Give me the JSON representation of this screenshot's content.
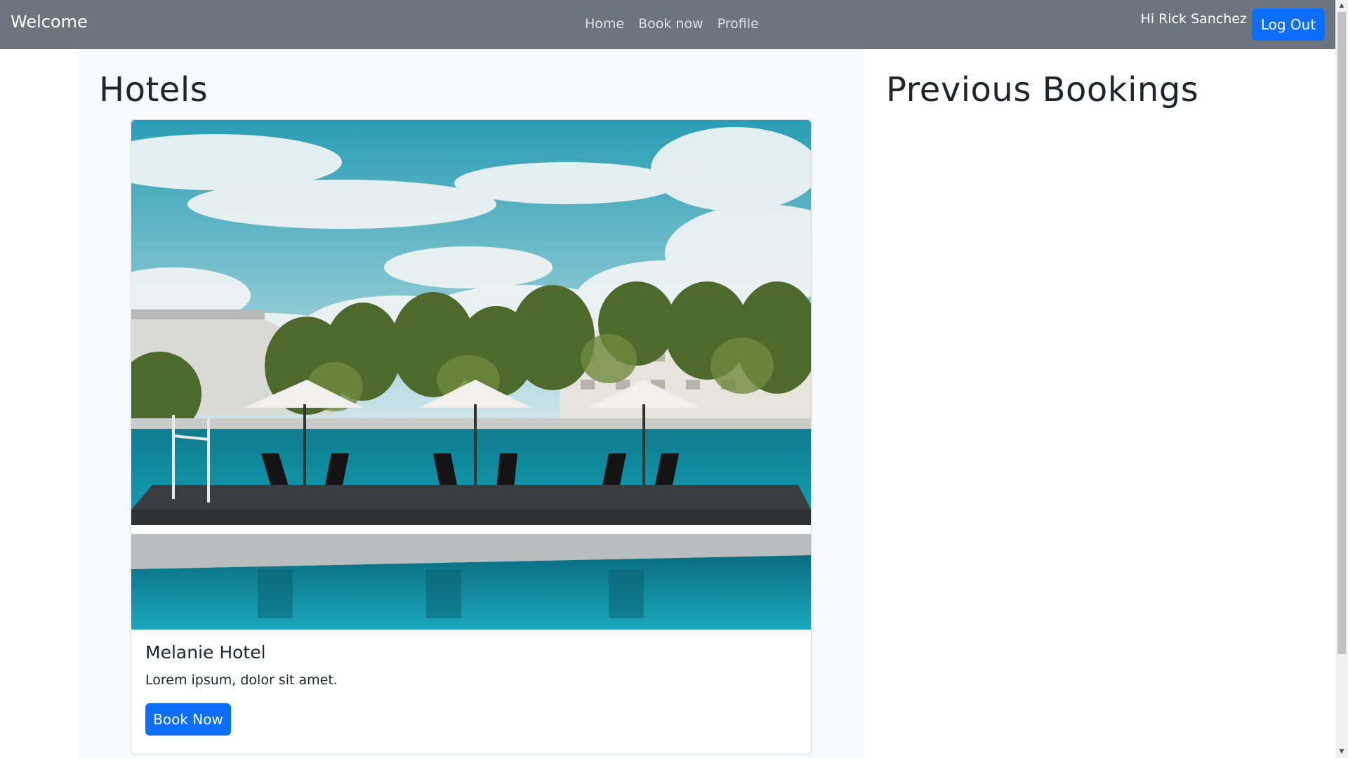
{
  "navbar": {
    "brand": "Welcome",
    "links": [
      {
        "label": "Home"
      },
      {
        "label": "Book now"
      },
      {
        "label": "Profile"
      }
    ],
    "greeting": "Hi Rick Sanchez",
    "logout_label": "Log Out"
  },
  "hotels": {
    "title": "Hotels",
    "cards": [
      {
        "name": "Melanie Hotel",
        "description": "Lorem ipsum, dolor sit amet.",
        "button_label": "Book Now"
      }
    ]
  },
  "bookings": {
    "title": "Previous Bookings"
  },
  "colors": {
    "navbar_bg": "#6c757d",
    "primary": "#0d6efd",
    "light_bg": "#f8f9fa"
  }
}
